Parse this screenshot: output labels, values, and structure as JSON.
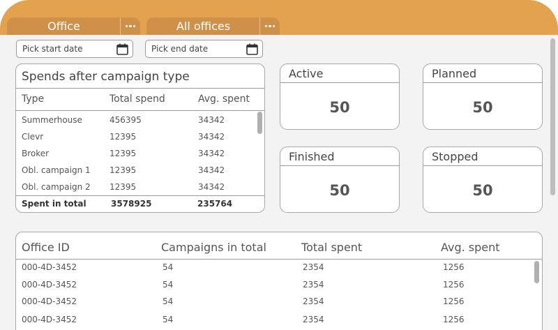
{
  "tabs": [
    {
      "label": "Office"
    },
    {
      "label": "All offices"
    }
  ],
  "dates": {
    "start_placeholder": "Pick start date",
    "end_placeholder": "Pick end date"
  },
  "spends": {
    "title": "Spends after campaign type",
    "columns": [
      "Type",
      "Total spend",
      "Avg. spent"
    ],
    "rows": [
      [
        "Summerhouse",
        "456395",
        "34342"
      ],
      [
        "Clevr",
        "12395",
        "34342"
      ],
      [
        "Broker",
        "12395",
        "34342"
      ],
      [
        "Obl. campaign 1",
        "12395",
        "34342"
      ],
      [
        "Obl. campaign 2",
        "12395",
        "34342"
      ]
    ],
    "footer": [
      "Spent in total",
      "3578925",
      "235764"
    ]
  },
  "stats": [
    {
      "label": "Active",
      "value": "50"
    },
    {
      "label": "Planned",
      "value": "50"
    },
    {
      "label": "Finished",
      "value": "50"
    },
    {
      "label": "Stopped",
      "value": "50"
    }
  ],
  "offices": {
    "columns": [
      "Office ID",
      "Campaigns in total",
      "Total spent",
      "Avg. spent"
    ],
    "rows": [
      [
        "000-4D-3452",
        "54",
        "2354",
        "1256"
      ],
      [
        "000-4D-3452",
        "54",
        "2354",
        "1256"
      ],
      [
        "000-4D-3452",
        "54",
        "2354",
        "1256"
      ],
      [
        "000-4D-3452",
        "54",
        "2354",
        "1256"
      ]
    ]
  },
  "colors": {
    "header": "#e3a24e",
    "tab": "#cf914a",
    "background": "#f3f3f3"
  }
}
